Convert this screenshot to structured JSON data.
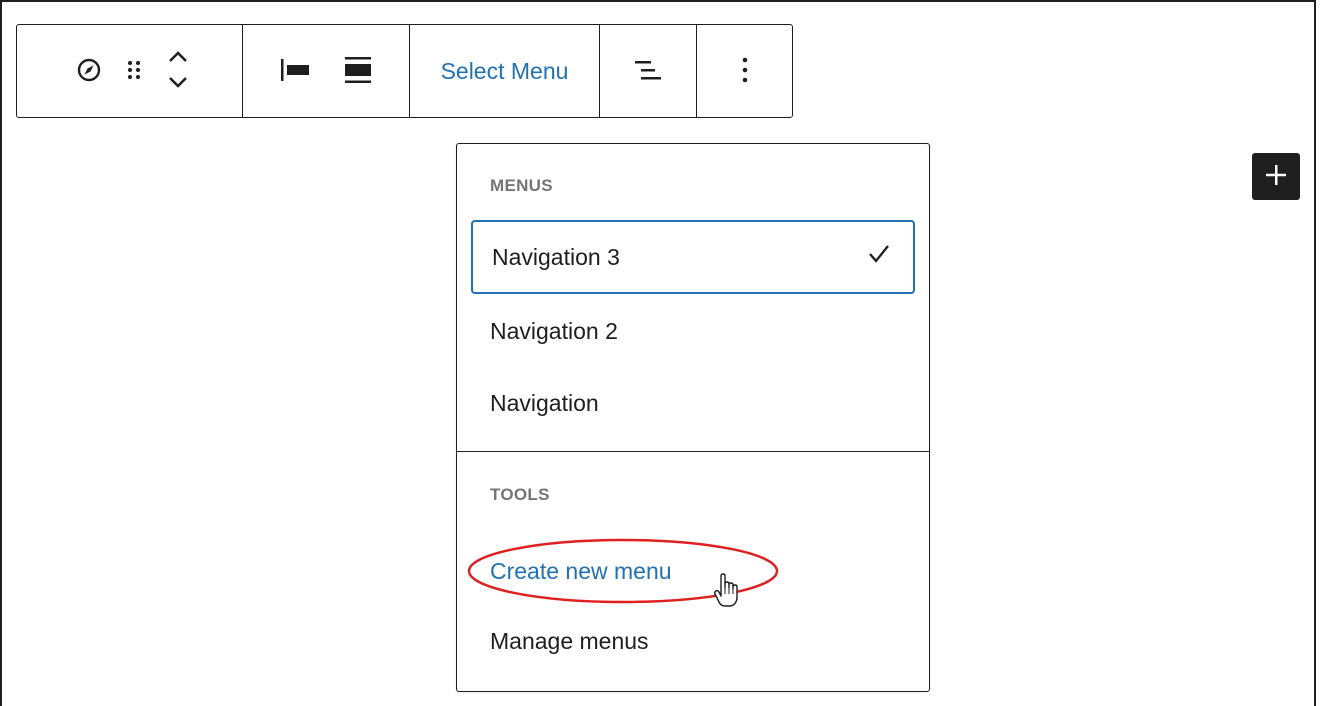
{
  "toolbar": {
    "select_menu_label": "Select Menu",
    "icons": [
      "compass-icon",
      "drag-handle-icon",
      "move-up-down-icon",
      "justify-left-icon",
      "justify-center-icon",
      "list-view-icon",
      "more-options-icon"
    ]
  },
  "dropdown": {
    "menus_heading": "MENUS",
    "menus": [
      {
        "label": "Navigation 3",
        "selected": true
      },
      {
        "label": "Navigation 2",
        "selected": false
      },
      {
        "label": "Navigation",
        "selected": false
      }
    ],
    "tools_heading": "TOOLS",
    "tools": [
      {
        "label": "Create new menu"
      },
      {
        "label": "Manage menus"
      }
    ]
  },
  "colors": {
    "accent": "#2271b1",
    "text": "#1e1e1e",
    "heading": "#757575",
    "annotation": "#e02020"
  }
}
